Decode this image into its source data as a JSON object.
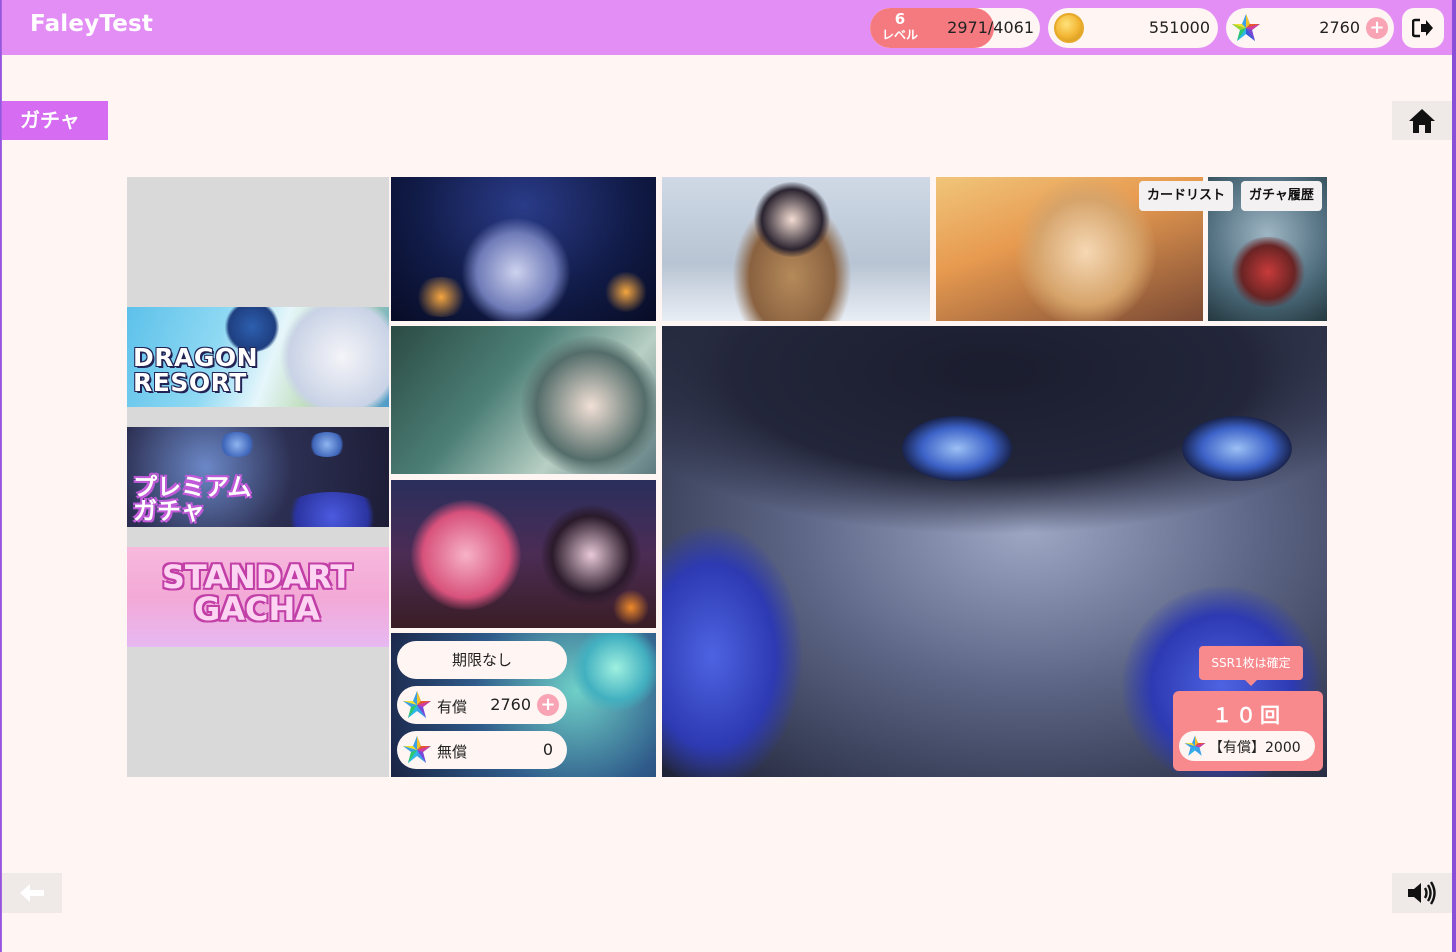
{
  "header": {
    "app_title": "FaleyTest",
    "level": {
      "value": "6",
      "label": "レベル",
      "xp_text": "2971/4061",
      "xp_fraction": 0.73
    },
    "coins": {
      "value": "551000",
      "icon": "gold-coin-icon"
    },
    "gems": {
      "value": "2760",
      "icon": "rainbow-star-icon",
      "plus_label": "+"
    },
    "logout_icon": "logout-icon"
  },
  "page": {
    "title": "ガチャ",
    "home_icon": "home-icon"
  },
  "banners": [
    {
      "label_line1": "DRAGON",
      "label_line2": "RESORT"
    },
    {
      "label_line1": "プレミアム",
      "label_line2": "ガチャ"
    },
    {
      "label_line1": "STANDART",
      "label_line2": "GACHA"
    }
  ],
  "overlay_buttons": {
    "card_list": "カードリスト",
    "history": "ガチャ履歴"
  },
  "currency": {
    "limit_label": "期限なし",
    "paid_label": "有償",
    "paid_value": "2760",
    "paid_plus": "+",
    "free_label": "無償",
    "free_value": "0"
  },
  "draw": {
    "guarantee": "SSR1枚は確定",
    "count_label": "１０回",
    "cost_text": "【有償】2000"
  },
  "colors": {
    "header_bg": "#e28ef4",
    "page_bg": "#fff5f3",
    "accent_pink": "#f88a8e",
    "tab_purple": "#d56cf2"
  }
}
